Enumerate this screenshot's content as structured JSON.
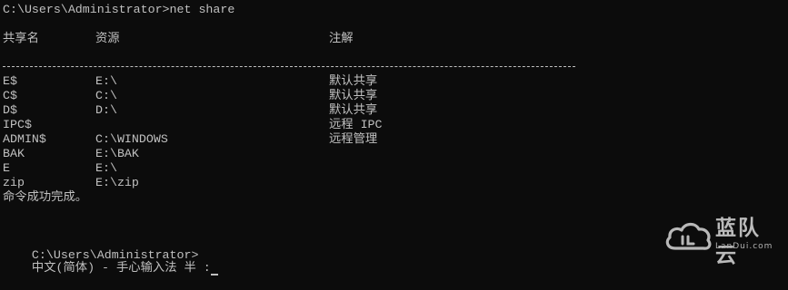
{
  "console": {
    "prompt_command": "C:\\Users\\Administrator>net share",
    "header": {
      "col_name": "共享名",
      "col_resource": "资源",
      "col_remark": "注解"
    },
    "rows": [
      {
        "name": "E$",
        "resource": "E:\\",
        "remark": "默认共享"
      },
      {
        "name": "C$",
        "resource": "C:\\",
        "remark": "默认共享"
      },
      {
        "name": "D$",
        "resource": "D:\\",
        "remark": "默认共享"
      },
      {
        "name": "IPC$",
        "resource": "",
        "remark": "远程 IPC"
      },
      {
        "name": "ADMIN$",
        "resource": "C:\\WINDOWS",
        "remark": "远程管理"
      },
      {
        "name": "BAK",
        "resource": "E:\\BAK",
        "remark": ""
      },
      {
        "name": "E",
        "resource": "E:\\",
        "remark": ""
      },
      {
        "name": "zip",
        "resource": "E:\\zip",
        "remark": ""
      }
    ],
    "completion": "命令成功完成。",
    "final_prompt": "C:\\Users\\Administrator>",
    "ime_status": "中文(简体) - 手心输入法 半 :"
  },
  "watermark": {
    "text": "蓝队云",
    "subtext": "LanDui.com",
    "icon": "cloud-logo-icon"
  },
  "colors": {
    "background": "#0c0c0c",
    "foreground": "#c0c0c0"
  }
}
